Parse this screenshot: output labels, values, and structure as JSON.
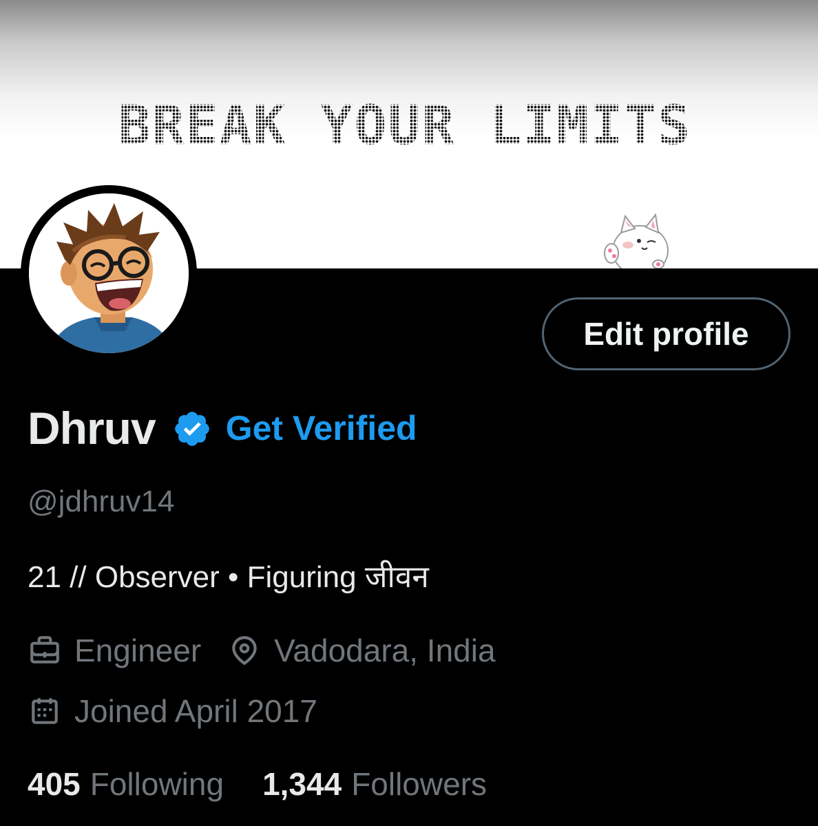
{
  "banner": {
    "title": "BREAK YOUR LIMITS"
  },
  "profile": {
    "edit_label": "Edit profile",
    "name": "Dhruv",
    "get_verified": "Get Verified",
    "handle": "@jdhruv14",
    "bio": "21 // Observer • Figuring जीवन",
    "profession": "Engineer",
    "location": "Vadodara, India",
    "joined": "Joined April 2017"
  },
  "stats": {
    "following_count": "405",
    "following_label": "Following",
    "followers_count": "1,344",
    "followers_label": "Followers"
  },
  "colors": {
    "accent": "#1d9bf0",
    "text_primary": "#e7e9ea",
    "text_secondary": "#71767b",
    "border": "#536471",
    "background": "#000000"
  },
  "icons": {
    "verified": "verified-badge-icon",
    "profession": "briefcase-icon",
    "location": "location-pin-icon",
    "joined": "calendar-icon"
  }
}
